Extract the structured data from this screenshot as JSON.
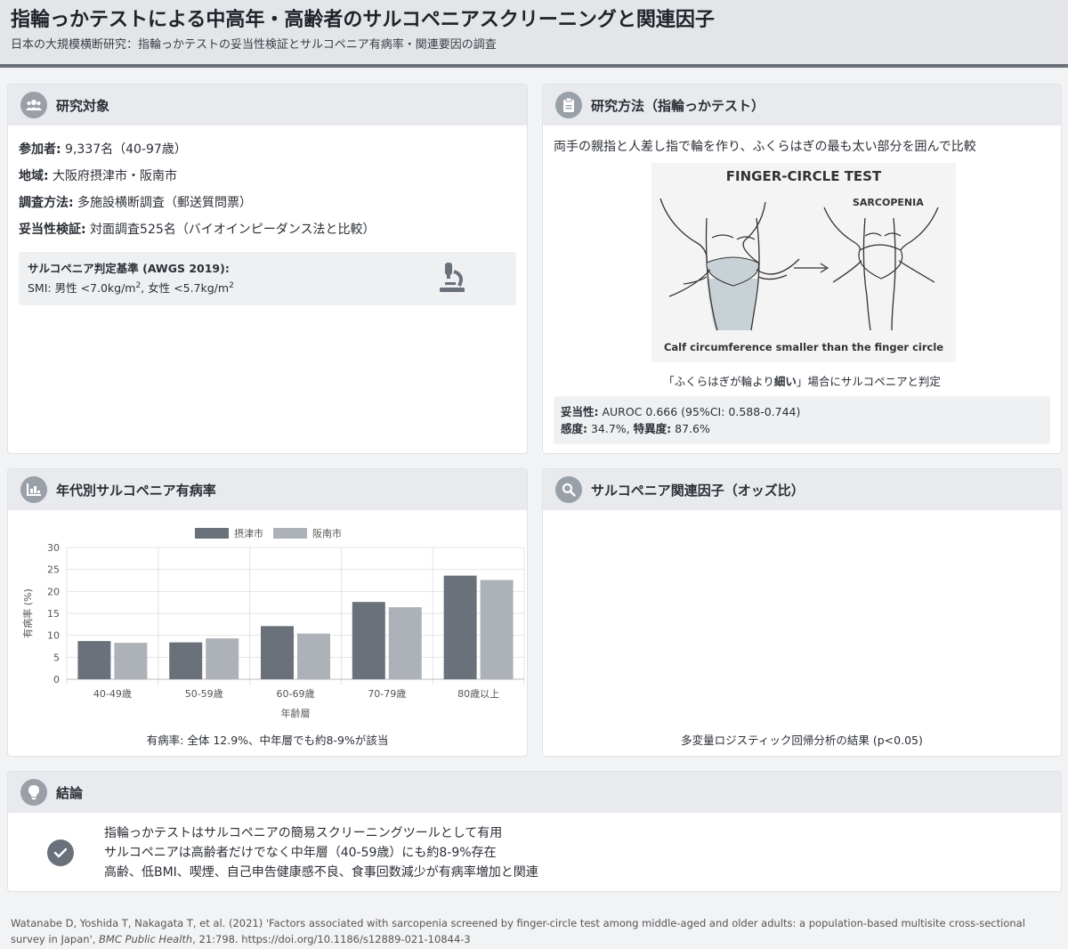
{
  "header": {
    "title": "指輪っかテストによる中高年・高齢者のサルコペニアスクリーニングと関連因子",
    "subtitle": "日本の大規模横断研究：指輪っかテストの妥当性検証とサルコペニア有病率・関連要因の調査"
  },
  "target": {
    "title": "研究対象",
    "rows": [
      {
        "label": "参加者:",
        "value": " 9,337名（40-97歳）"
      },
      {
        "label": "地域:",
        "value": " 大阪府摂津市・阪南市"
      },
      {
        "label": "調査方法:",
        "value": " 多施設横断調査（郵送質問票）"
      },
      {
        "label": "妥当性検証:",
        "value": " 対面調査525名（バイオインピーダンス法と比較）"
      }
    ],
    "criteria_title": "サルコペニア判定基準 (AWGS 2019):",
    "criteria_smi": "SMI: 男性 <7.0kg/m",
    "criteria_sep": ", 女性 <5.7kg/m",
    "criteria_sup": "2"
  },
  "method": {
    "title": "研究方法（指輪っかテスト）",
    "desc": "両手の親指と人差し指で輪を作り、ふくらはぎの最も太い部分を囲んで比較",
    "illus_title": "FINGER-CIRCLE TEST",
    "illus_sarc": "SARCOPENIA",
    "illus_caption": "Calf circumference smaller than the finger circle",
    "judge_pre": "「ふくらはぎが輪より",
    "judge_bold": "細い",
    "judge_post": "」場合にサルコペニアと判定",
    "validity_label": "妥当性:",
    "validity_value": " AUROC 0.666 (95%CI: 0.588-0.744)",
    "sens_label": "感度:",
    "sens_value": " 34.7%, ",
    "spec_label": "特異度:",
    "spec_value": " 87.6%"
  },
  "prevalence": {
    "title": "年代別サルコペニア有病率",
    "note": "有病率: 全体 12.9%、中年層でも約8-9%が該当"
  },
  "factors": {
    "title": "サルコペニア関連因子（オッズ比）",
    "note": "多変量ロジスティック回帰分析の結果 (p<0.05)"
  },
  "conclusion": {
    "title": "結論",
    "items": [
      "指輪っかテストはサルコペニアの簡易スクリーニングツールとして有用",
      "サルコペニアは高齢者だけでなく中年層（40-59歳）にも約8-9%存在",
      "高齢、低BMI、喫煙、自己申告健康感不良、食事回数減少が有病率増加と関連"
    ]
  },
  "footer": {
    "citation": "Watanabe D, Yoshida T, Nakagata T, et al. (2021) 'Factors associated with sarcopenia screened by finger-circle test among middle-aged and older adults: a population-based multisite cross-sectional survey in Japan', ",
    "journal": "BMC Public Health",
    "rest": ", 21:798. https://doi.org/10.1186/s12889-021-10844-3"
  },
  "colors": {
    "dark_bar": "#6b717a",
    "light_bar": "#adb2b8"
  },
  "chart_data": {
    "type": "bar",
    "categories": [
      "40-49歳",
      "50-59歳",
      "60-69歳",
      "70-79歳",
      "80歳以上"
    ],
    "series": [
      {
        "name": "摂津市",
        "values": [
          8.7,
          8.4,
          12.1,
          17.6,
          23.6
        ]
      },
      {
        "name": "阪南市",
        "values": [
          8.3,
          9.3,
          10.4,
          16.4,
          22.6
        ]
      }
    ],
    "xlabel": "年齢層",
    "ylabel": "有病率 (%)",
    "ylim": [
      0,
      30
    ],
    "yticks": [
      "0",
      "5",
      "10",
      "15",
      "20",
      "25",
      "30"
    ],
    "grid": true,
    "legend": "top-center"
  }
}
